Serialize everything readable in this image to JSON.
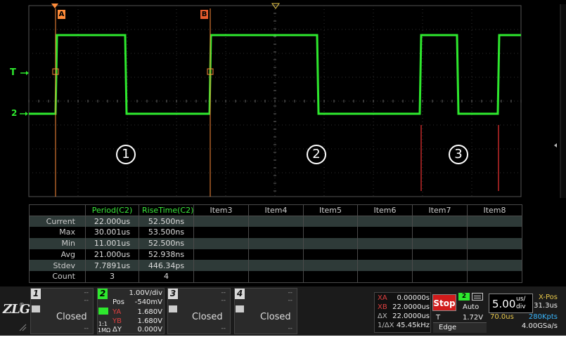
{
  "cursors": {
    "a_label": "A",
    "b_label": "B"
  },
  "markers": {
    "trigger_label": "T",
    "ch2_label": "2"
  },
  "annotations": [
    "1",
    "2",
    "3"
  ],
  "measure": {
    "headers": [
      "",
      "Period(C2)",
      "RiseTime(C2)",
      "Item3",
      "Item4",
      "Item5",
      "Item6",
      "Item7",
      "Item8"
    ],
    "rows": [
      {
        "label": "Current",
        "period": "22.000us",
        "rise": "52.500ns"
      },
      {
        "label": "Max",
        "period": "30.001us",
        "rise": "53.500ns"
      },
      {
        "label": "Min",
        "period": "11.001us",
        "rise": "52.500ns"
      },
      {
        "label": "Avg",
        "period": "21.000us",
        "rise": "52.938ns"
      },
      {
        "label": "Stdev",
        "period": "7.7891us",
        "rise": "446.34ps"
      },
      {
        "label": "Count",
        "period": "3",
        "rise": "4"
      }
    ]
  },
  "channels": {
    "ch1": {
      "num": "1",
      "state": "Closed"
    },
    "ch2": {
      "num": "2",
      "vdiv": "1.00V/div",
      "pos_label": "Pos",
      "pos": "-540mV",
      "ya_label": "YA",
      "ya": "1.680V",
      "yb_label": "YB",
      "yb": "1.680V",
      "coupling": "1:1",
      "imp": "1MΩ",
      "dy_label": "ΔY",
      "dy": "0.000V"
    },
    "ch3": {
      "num": "3",
      "state": "Closed"
    },
    "ch4": {
      "num": "4",
      "state": "Closed"
    },
    "dash": "--"
  },
  "cursor_panel": {
    "xa_label": "XA",
    "xa": "0.00000s",
    "xb_label": "XB",
    "xb": "22.0000us",
    "dx_label": "ΔX",
    "dx": "22.0000us",
    "inv_label": "1/ΔX",
    "inv": "45.45kHz"
  },
  "acq": {
    "run_state": "Stop"
  },
  "trigger": {
    "source": "2",
    "mode": "Auto",
    "t_label": "T",
    "level": "1.72V",
    "type": "Edge"
  },
  "timebase": {
    "value": "5.00",
    "unit_top": "us/",
    "unit_bot": "div",
    "xpos_label": "X-Pos",
    "xpos": "31.3us",
    "delay": "70.0us",
    "depth": "280Kpts",
    "rate": "4.00GSa/s"
  },
  "logo": {
    "text": "ZLG",
    "reg": "®"
  },
  "colors": {
    "ch2": "#2ee82e",
    "cursor": "#ff8c3a",
    "xb": "#e04040",
    "accent_stop": "#d11b1b"
  }
}
